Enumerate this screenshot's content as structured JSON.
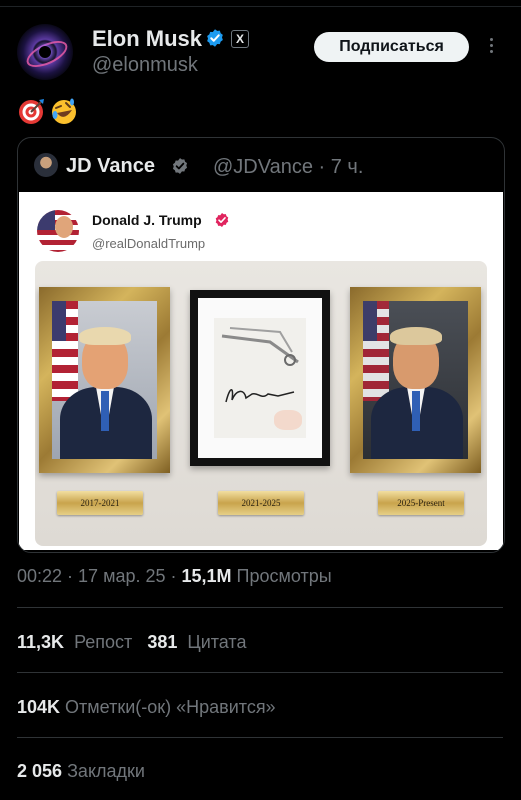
{
  "post": {
    "author_name": "Elon Musk",
    "author_handle": "@elonmusk",
    "follow_label": "Подписаться",
    "affiliation_badge": "X",
    "emojis": [
      "direct-hit-emoji",
      "rolling-on-floor-laughing-emoji"
    ]
  },
  "quote": {
    "name": "JD Vance",
    "handle_time": "@JDVance · 7 ч.",
    "inner": {
      "name": "Donald J. Trump",
      "handle": "@realDonaldTrump",
      "plaques": [
        "2017-2021",
        "2021-2025",
        "2025-Present"
      ]
    }
  },
  "meta": {
    "time": "00:22",
    "sep1": " · ",
    "date": "17 мар. 25",
    "sep2": " · ",
    "views": "15,1M",
    "views_label": " Просмотры"
  },
  "stats": {
    "reposts": "11,3K",
    "reposts_label": "Репост",
    "quotes": "381",
    "quotes_label": "Цитата",
    "likes": "104K",
    "likes_label": "Отметки(-ок) «Нравится»",
    "bookmarks": "2 056",
    "bookmarks_label": "Закладки"
  },
  "colors": {
    "background": "#000000",
    "verified_blue": "#1d9bf0",
    "trump_badge": "#e0245e",
    "muted_text": "#71767b"
  }
}
